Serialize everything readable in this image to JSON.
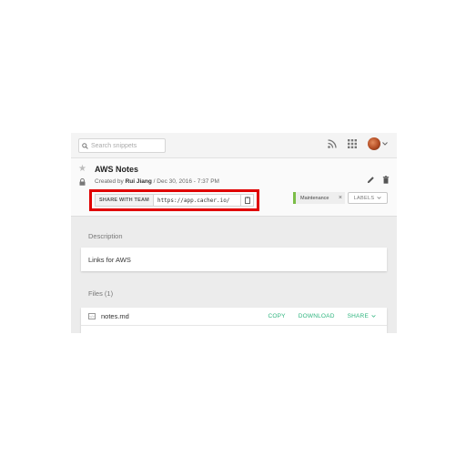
{
  "search": {
    "placeholder": "Search snippets"
  },
  "snippet": {
    "title": "AWS Notes",
    "created_prefix": "Created by ",
    "author": "Rui Jiang",
    "created_suffix": " / Dec 30, 2016 - 7:37 PM",
    "share_label": "SHARE WITH TEAM",
    "share_url": "https://app.cacher.io/",
    "tag": "Maintenance",
    "tag_color": "#7bbd47",
    "labels_button": "LABELS",
    "description_heading": "Description",
    "description": "Links for AWS",
    "files_heading": "Files (1)"
  },
  "file": {
    "name": "notes.md",
    "copy": "COPY",
    "download": "DOWNLOAD",
    "share": "SHARE"
  },
  "colors": {
    "highlight": "#e00000",
    "action": "#2fb57f"
  },
  "icons": [
    "search-icon",
    "rss-icon",
    "apps-grid-icon",
    "star-icon",
    "lock-icon",
    "edit-icon",
    "trash-icon",
    "clipboard-icon",
    "close-icon",
    "chevron-down-icon",
    "file-icon"
  ]
}
